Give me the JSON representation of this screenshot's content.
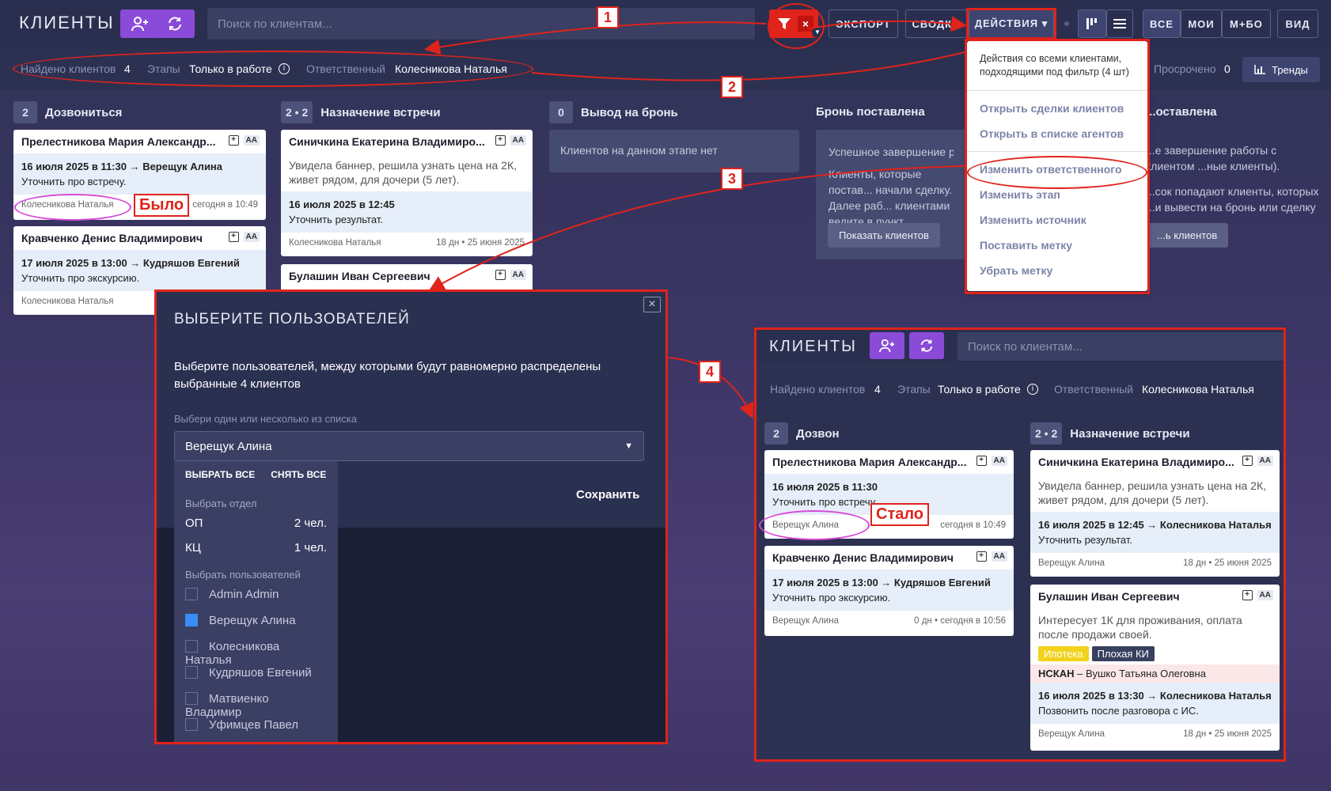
{
  "header": {
    "title": "КЛИЕНТЫ",
    "search_placeholder": "Поиск по клиентам...",
    "export": "ЭКСПОРТ",
    "summary": "СВОДКА",
    "actions": "ДЕЙСТВИЯ ▾",
    "filter_all": "ВСЕ",
    "filter_mine": "МОИ",
    "filter_mbo": "М+БО",
    "view": "ВИД",
    "trends": "Тренды"
  },
  "filter": {
    "found_label": "Найдено клиентов",
    "found_value": "4",
    "stages_label": "Этапы",
    "stages_value": "Только в работе",
    "resp_label": "Ответственный",
    "resp_value": "Колесникова Наталья",
    "overdue_label": "Просрочено",
    "overdue_value": "0"
  },
  "columns": [
    {
      "count": "2",
      "title": "Дозвониться"
    },
    {
      "count": "2 • 2",
      "title": "Назначение встречи"
    },
    {
      "count": "0",
      "title": "Вывод на бронь"
    },
    {
      "title": "Бронь поставлена"
    },
    {
      "title": "...оставлена"
    }
  ],
  "cards": {
    "c1": {
      "name": "Прелестникова Мария Александр...",
      "task": "16 июля 2025 в 11:30 → Верещук Алина",
      "task2": "Уточнить про встречу.",
      "owner": "Колесникова Наталья",
      "time": "сегодня в 10:49"
    },
    "c2": {
      "name": "Кравченко Денис Владимирович",
      "task": "17 июля 2025 в 13:00 → Кудряшов Евгений",
      "task2": "Уточнить про экскурсию.",
      "owner": "Колесникова Наталья"
    },
    "c3": {
      "name": "Синичкина Екатерина Владимиро...",
      "note": "Увидела баннер, решила узнать цена на 2К, живет рядом, для дочери (5 лет).",
      "task": "16 июля 2025 в 12:45",
      "task2": "Уточнить результат.",
      "owner": "Колесникова Наталья",
      "time": "18 дн • 25 июня 2025"
    },
    "c4": {
      "name": "Булашин Иван Сергеевич"
    },
    "aa": "AA",
    "plus": "+"
  },
  "empty_stage": "Клиентов на данном этапе нет",
  "booking": {
    "text1": "Успешное завершение раб...",
    "text2": "Клиенты, которые постав... начали сделку. Далее раб... клиентами ведите в пункт...",
    "button": "Показать клиентов",
    "right1": "...е завершение работы с клиентом ...ные клиенты).",
    "right2": "...сок попадают клиенты, которых ...и вывести на бронь или сделку",
    "right_btn": "...ь клиентов"
  },
  "dropdown": {
    "hint": "Действия со всеми клиентами, подходящими под фильтр (4 шт)",
    "items": [
      "Открыть сделки клиентов",
      "Открыть в списке агентов",
      "Изменить ответственного",
      "Изменить этап",
      "Изменить источник",
      "Поставить метку",
      "Убрать метку"
    ]
  },
  "modal": {
    "title": "ВЫБЕРИТЕ ПОЛЬЗОВАТЕЛЕЙ",
    "desc": "Выберите пользователей, между которыми будут равномерно распределены выбранные 4 клиентов",
    "label": "Выбери один или несколько из списка",
    "selected": "Верещук Алина",
    "select_all": "ВЫБРАТЬ ВСЕ",
    "clear_all": "СНЯТЬ ВСЕ",
    "dept_header": "Выбрать отдел",
    "depts": [
      {
        "name": "ОП",
        "count": "2 чел."
      },
      {
        "name": "КЦ",
        "count": "1 чел."
      }
    ],
    "users_header": "Выбрать пользователей",
    "users": [
      "Admin Admin",
      "Верещук Алина",
      "Колесникова Наталья",
      "Кудряшов Евгений",
      "Матвиенко Владимир",
      "Уфимцев Павел"
    ],
    "save": "Сохранить",
    "close": "×"
  },
  "annotations": {
    "m1": "1",
    "m2": "2",
    "m3": "3",
    "m4": "4",
    "before": "Было",
    "after": "Стало"
  },
  "inset": {
    "title": "КЛИЕНТЫ",
    "search_placeholder": "Поиск по клиентам...",
    "found_label": "Найдено клиентов",
    "found_value": "4",
    "stages_label": "Этапы",
    "stages_value": "Только в работе",
    "resp_label": "Ответственный",
    "resp_value": "Колесникова Наталья",
    "col1_count": "2",
    "col1_title": "Дозвон",
    "col2_count": "2 • 2",
    "col2_title": "Назначение встречи",
    "a": {
      "name": "Прелестникова Мария Александр...",
      "task": "16 июля 2025 в 11:30",
      "task2": "Уточнить про встречу.",
      "owner": "Верещук Алина",
      "time": "сегодня в 10:49"
    },
    "b": {
      "name": "Кравченко Денис Владимирович",
      "task": "17 июля 2025 в 13:00 → Кудряшов Евгений",
      "task2": "Уточнить про экскурсию.",
      "owner": "Верещук Алина",
      "time": "0 дн • сегодня в 10:56"
    },
    "c": {
      "name": "Синичкина Екатерина Владимиро...",
      "note": "Увидела баннер, решила узнать цена на 2К, живет рядом, для дочери (5 лет).",
      "task": "16 июля 2025 в 12:45 → Колесникова Наталья",
      "task2": "Уточнить результат.",
      "owner": "Верещук Алина",
      "time": "18 дн • 25 июня 2025"
    },
    "d": {
      "name": "Булашин Иван Сергеевич",
      "note": "Интересует 1К для проживания, оплата после продажи своей.",
      "tag1": "Ипотека",
      "tag2": "Плохая КИ",
      "nskan": "НСКАН",
      "nskan_rest": " – Вушко Татьяна Олеговна",
      "task": "16 июля 2025 в 13:30 → Колесникова Наталья",
      "task2": "Позвонить после разговора с ИС.",
      "owner": "Верещук Алина",
      "time": "18 дн • 25 июня 2025"
    }
  },
  "colors": {
    "accent": "#8a4bd8",
    "annotation": "#e0231b",
    "highlight_oval": "#d649d6"
  }
}
